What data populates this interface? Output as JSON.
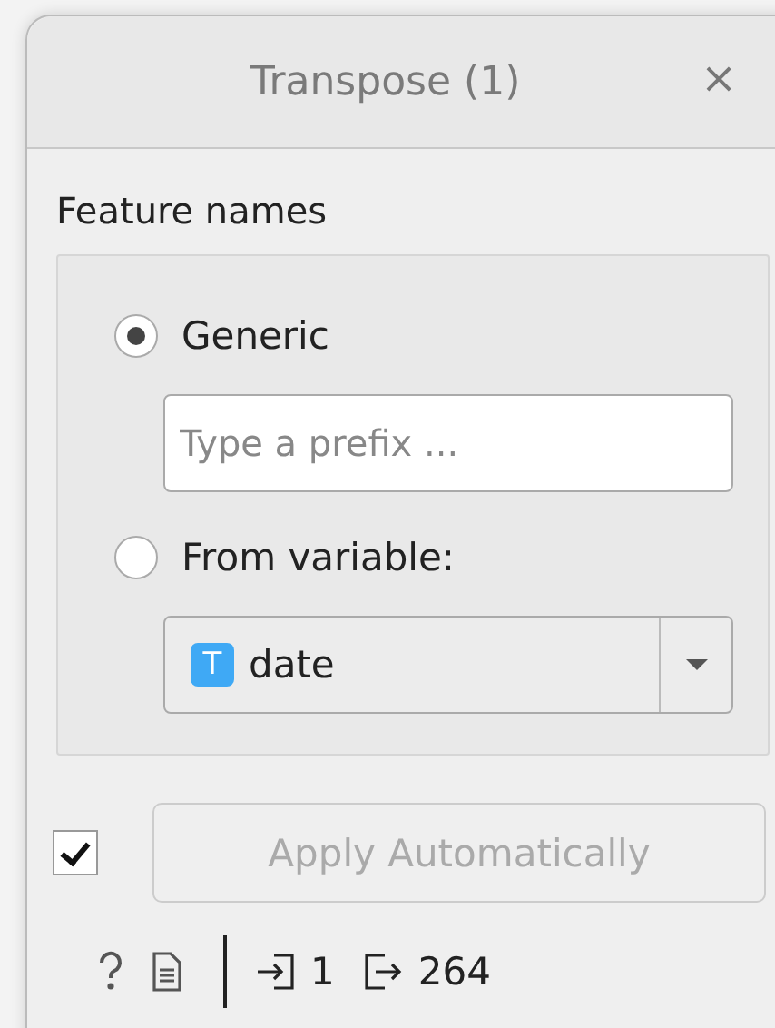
{
  "window": {
    "title": "Transpose (1)",
    "close": "×"
  },
  "feature_names": {
    "title": "Feature names",
    "options": [
      {
        "kind": "generic",
        "label": "Generic",
        "selected": true
      },
      {
        "kind": "variable",
        "label": "From variable:",
        "selected": false
      }
    ],
    "prefix": {
      "placeholder": "Type a prefix ..."
    },
    "variable": {
      "type_badge": "T",
      "value": "date"
    }
  },
  "auto_apply": {
    "checked": true,
    "label": "Apply Automatically",
    "disabled": true
  },
  "status_bar": {
    "input_count": "1",
    "output_count": "264"
  }
}
